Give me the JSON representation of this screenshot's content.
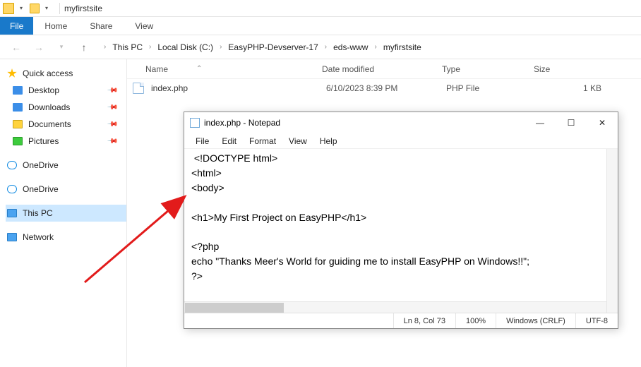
{
  "titlebar": {
    "title": "myfirstsite"
  },
  "ribbon": {
    "file": "File",
    "tabs": [
      "Home",
      "Share",
      "View"
    ]
  },
  "breadcrumb": [
    "This PC",
    "Local Disk (C:)",
    "EasyPHP-Devserver-17",
    "eds-www",
    "myfirstsite"
  ],
  "columns": {
    "name": "Name",
    "date": "Date modified",
    "type": "Type",
    "size": "Size"
  },
  "files": [
    {
      "name": "index.php",
      "date": "6/10/2023 8:39 PM",
      "type": "PHP File",
      "size": "1 KB"
    }
  ],
  "sidebar": {
    "quick": "Quick access",
    "pinned": [
      "Desktop",
      "Downloads",
      "Documents",
      "Pictures"
    ],
    "onedrive": "OneDrive",
    "thispc": "This PC",
    "network": "Network"
  },
  "notepad": {
    "title": "index.php - Notepad",
    "menu": [
      "File",
      "Edit",
      "Format",
      "View",
      "Help"
    ],
    "content": " <!DOCTYPE html>\n<html>\n<body>\n\n<h1>My First Project on EasyPHP</h1>\n\n<?php\necho \"Thanks Meer's World for guiding me to install EasyPHP on Windows!!\";\n?>\n\n</body>\n</html>",
    "status": {
      "pos": "Ln 8, Col 73",
      "zoom": "100%",
      "eol": "Windows (CRLF)",
      "enc": "UTF-8"
    }
  }
}
